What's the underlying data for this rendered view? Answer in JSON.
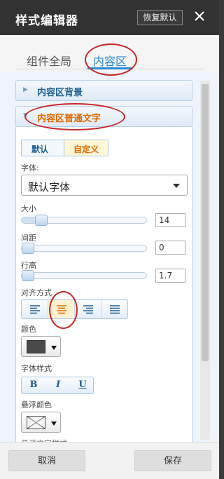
{
  "window": {
    "title": "样式编辑器",
    "reset_label": "恢复默认"
  },
  "tabs": [
    {
      "label": "组件全局"
    },
    {
      "label": "内容区"
    }
  ],
  "sections": {
    "background": {
      "label": "内容区背景"
    },
    "text": {
      "label": "内容区普通文字"
    }
  },
  "mode": {
    "default_label": "默认",
    "custom_label": "自定义"
  },
  "font": {
    "label": "字体:",
    "value": "默认字体"
  },
  "size": {
    "label": "大小",
    "value": "14",
    "level": 0.12
  },
  "spacing": {
    "label": "间距",
    "value": "0",
    "level": 0.0
  },
  "line_height": {
    "label": "行高",
    "value": "1.7",
    "level": 0.0
  },
  "align": {
    "label": "对齐方式",
    "options": [
      "align-left",
      "align-center",
      "align-right",
      "align-justify"
    ],
    "selected": "align-center"
  },
  "color": {
    "label": "颜色",
    "value": "#4a4a4a"
  },
  "font_style": {
    "label": "字体样式",
    "bold": "B",
    "italic": "I",
    "underline": "U"
  },
  "hover_color": {
    "label": "悬浮颜色"
  },
  "hover_style_partial": "悬浮文字样式",
  "footer": {
    "cancel_label": "取消",
    "save_label": "保存"
  }
}
